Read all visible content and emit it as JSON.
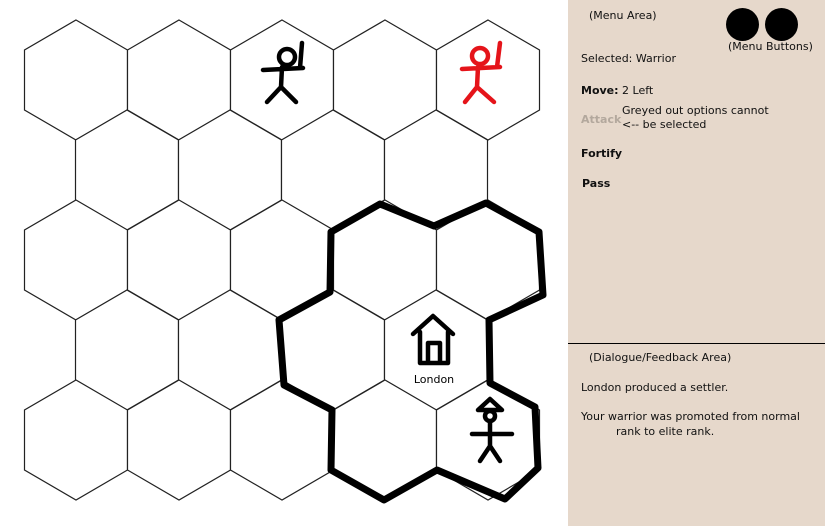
{
  "board": {
    "city": {
      "name": "London"
    },
    "units": [
      {
        "type": "warrior",
        "owner": "player",
        "color": "#000000"
      },
      {
        "type": "warrior",
        "owner": "enemy",
        "color": "#e5141a"
      },
      {
        "type": "settler",
        "owner": "player",
        "color": "#000000"
      }
    ]
  },
  "menu": {
    "area_label": "(Menu Area)",
    "buttons_label": "(Menu Buttons)",
    "selected": "Selected: Warrior",
    "move_label": "Move:",
    "move_value": "2 Left",
    "attack": "Attack",
    "note_line1": "Greyed out options cannot",
    "note_line2": "<-- be selected",
    "fortify": "Fortify",
    "pass": "Pass"
  },
  "dialogue": {
    "area_label": "(Dialogue/Feedback Area)",
    "messages": [
      "London produced a settler.",
      "Your warrior was promoted from normal",
      "rank to elite rank."
    ]
  },
  "colors": {
    "panel_bg": "#e6d8cb",
    "disabled_text": "#b3a89d",
    "enemy": "#e5141a",
    "player": "#000000"
  }
}
